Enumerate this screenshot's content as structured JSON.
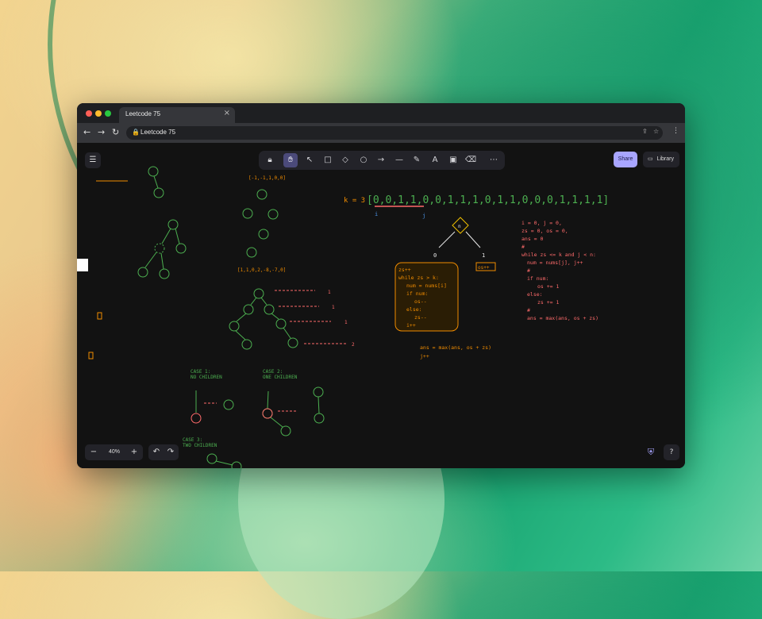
{
  "browser": {
    "tab_title": "Leetcode 75",
    "tab_close": "×",
    "address": "Leetcode 75",
    "back": "←",
    "forward": "→",
    "reload": "↻"
  },
  "toolbar": {
    "tools": [
      "lock",
      "hand",
      "selection",
      "rectangle",
      "diamond",
      "ellipse",
      "arrow",
      "line",
      "draw",
      "text",
      "image",
      "eraser",
      "more"
    ],
    "hotkeys": [
      "",
      "",
      "1",
      "2",
      "3",
      "4",
      "5",
      "6",
      "7",
      "8",
      "9",
      "0",
      ""
    ]
  },
  "topbar": {
    "share_label": "Share",
    "library_label": "Library"
  },
  "footer": {
    "zoom_out": "−",
    "zoom_value": "40%",
    "zoom_in": "+",
    "undo": "↶",
    "redo": "↷",
    "help": "?"
  },
  "colors": {
    "green": "#4caf50",
    "orange": "#f08c00",
    "red": "#ff6b6b",
    "accent": "#a8a5ff"
  },
  "canvas": {
    "k_label": "k = 3",
    "array_text": "[0,0,1,1,0,0,1,1,1,0,1,1,0,0,0,1,1,1,1]",
    "pointer_i": "i",
    "pointer_j": "j",
    "diamond_label": "n",
    "branch_left": "0",
    "branch_right": "1",
    "zs_box": "os++",
    "code_box_lines": [
      "zs++",
      "while zs > k:",
      "  num = nums[i]",
      "  if num:",
      "    os--",
      "  else:",
      "    zs--",
      "  i++"
    ],
    "code_after": [
      "ans = max(ans, os + zs)",
      "j++"
    ],
    "code_right": [
      "i = 0, j = 0,",
      "zs = 0, os = 0,",
      "ans = 0",
      "#",
      "while zs <= k and j < n:",
      "  num = nums[j], j++",
      "  #",
      "  if num:",
      "    os += 1",
      "  else:",
      "    zs += 1",
      "  #",
      "  ans = max(ans, os + zs)"
    ],
    "arr1": "[-1,-1,1,0,0]",
    "arr2": "[1,1,0,2,-8,-7,0]",
    "case1": [
      "CASE 1:",
      "NO CHILDREN"
    ],
    "case2": [
      "CASE 2:",
      "ONE CHILDREN"
    ],
    "case3": [
      "CASE 3:",
      "TWO CHILDREN"
    ],
    "level_labels": [
      "1",
      "1",
      "1",
      "2"
    ]
  }
}
